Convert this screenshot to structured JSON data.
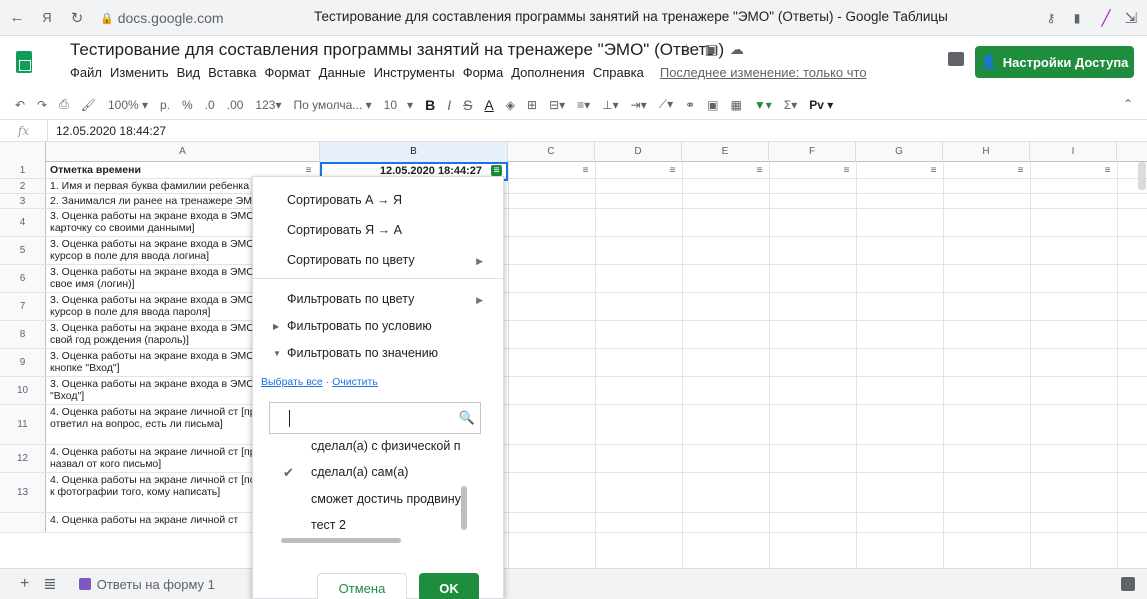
{
  "browser": {
    "url": "docs.google.com",
    "window_title": "Тестирование для составления программы занятий на тренажере \"ЭМО\" (Ответы) - Google Таблицы",
    "nav_text": "Я"
  },
  "doc": {
    "title": "Тестирование для составления программы занятий на тренажере \"ЭМО\" (Ответы)",
    "menu": [
      "Файл",
      "Изменить",
      "Вид",
      "Вставка",
      "Формат",
      "Данные",
      "Инструменты",
      "Форма",
      "Дополнения",
      "Справка"
    ],
    "last_edit": "Последнее изменение: только что",
    "share_label": "Настройки Доступа"
  },
  "toolbar": {
    "zoom": "100%",
    "currency": "р.",
    "percent": "%",
    "dec_less": ".0",
    "dec_more": ".00",
    "format_more": "123",
    "font": "По умолча...",
    "font_size": "10",
    "bold": "B",
    "italic": "I",
    "strike": "S",
    "text_color": "A",
    "sigma": "Σ",
    "script": "Pv"
  },
  "formula": {
    "fx": "fx",
    "value": "12.05.2020 18:44:27"
  },
  "columns": [
    "A",
    "B",
    "C",
    "D",
    "E",
    "F",
    "G",
    "H",
    "I"
  ],
  "rows": [
    {
      "num": "1",
      "a": "Отметка времени"
    },
    {
      "num": "2",
      "a": "1. Имя и первая буква фамилии ребенка"
    },
    {
      "num": "3",
      "a": "2. Занимался ли ранее на тренажере ЭМО"
    },
    {
      "num": "4",
      "a": "3. Оценка работы на экране входа в ЭМО [заполнил карточку со своими данными]"
    },
    {
      "num": "5",
      "a": "3. Оценка работы на экране входа в ЭМО [поставил курсор в поле для ввода логина]"
    },
    {
      "num": "6",
      "a": "3. Оценка работы на экране входа в ЭМО [напечатал свое имя (логин)]"
    },
    {
      "num": "7",
      "a": "3. Оценка работы на экране входа в ЭМО [поставил курсор в поле для ввода пароля]"
    },
    {
      "num": "8",
      "a": "3. Оценка работы на экране входа в ЭМО [напечатал свой год рождения (пароль)]"
    },
    {
      "num": "9",
      "a": "3. Оценка работы на экране входа в ЭМО курсор к кнопке \"Вход\"]"
    },
    {
      "num": "10",
      "a": "3. Оценка работы на экране входа в ЭМО на кнопку \"Вход\"]"
    },
    {
      "num": "11",
      "a": "4. Оценка работы на экране личной ст [правильно ответил на вопрос, есть ли письма]"
    },
    {
      "num": "12",
      "a": "4. Оценка работы на экране личной ст [правильно назвал от кого письмо]"
    },
    {
      "num": "13",
      "a": "4. Оценка работы на экране личной ст [подвел курсор к фотографии того, кому написать]"
    },
    {
      "num": "",
      "a": "4. Оценка работы на экране личной ст"
    }
  ],
  "cell_b1": "12.05.2020 18:44:27",
  "popup": {
    "sort_az": "Сортировать А → Я",
    "sort_za": "Сортировать Я → А",
    "sort_color": "Сортировать по цвету",
    "filter_color": "Фильтровать по цвету",
    "filter_condition": "Фильтровать по условию",
    "filter_value": "Фильтровать по значению",
    "select_all": "Выбрать все",
    "clear": "Очистить",
    "values": [
      {
        "label": "сделал(а) с физической п",
        "checked": false
      },
      {
        "label": "сделал(а) сам(а)",
        "checked": true
      },
      {
        "label": "сможет достичь продвину",
        "checked": false
      },
      {
        "label": "тест 2",
        "checked": false
      }
    ],
    "cancel": "Отмена",
    "ok": "OK"
  },
  "sheet_tab": "Ответы на форму 1",
  "colors": {
    "accent_green": "#1e8e3e",
    "selection_blue": "#1a73e8"
  }
}
